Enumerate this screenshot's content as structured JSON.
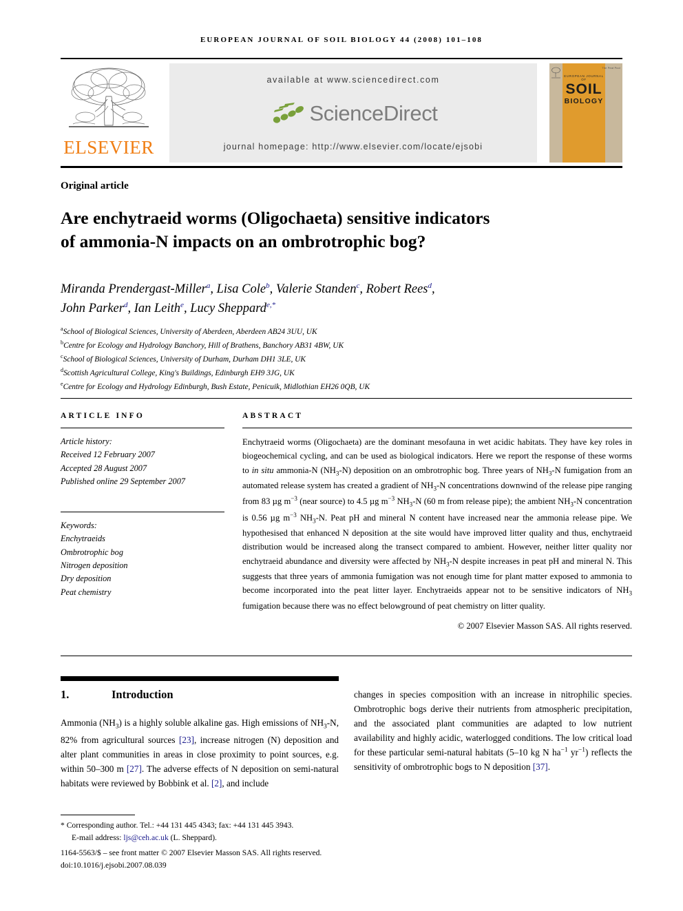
{
  "running_head": "EUROPEAN JOURNAL OF SOIL BIOLOGY 44 (2008) 101–108",
  "masthead": {
    "publisher": "ELSEVIER",
    "available_at": "available at www.sciencedirect.com",
    "sciencedirect": "ScienceDirect",
    "journal_homepage": "journal homepage: http://www.elsevier.com/locate/ejsobi",
    "cover": {
      "journal_line": "EUROPEAN JOURNAL OF",
      "title_line1": "SOIL",
      "title_line2": "BIOLOGY",
      "corner_note": "The Peat Pool"
    },
    "colors": {
      "elsevier_orange": "#F07E13",
      "sciencedirect_grey": "#7d7d7d",
      "sciencedirect_green": "#79A03A",
      "banner_grey": "#ebebeb",
      "cover_orange": "#E09B2D"
    }
  },
  "article_type": "Original article",
  "title_line1": "Are enchytraeid worms (Oligochaeta) sensitive indicators",
  "title_line2": "of ammonia-N impacts on an ombrotrophic bog?",
  "authors_line1_parts": [
    {
      "name": "Miranda Prendergast-Miller",
      "sup": "a"
    },
    {
      "name": "Lisa Cole",
      "sup": "b"
    },
    {
      "name": "Valerie Standen",
      "sup": "c"
    },
    {
      "name": "Robert Rees",
      "sup": "d"
    }
  ],
  "authors_line2_parts": [
    {
      "name": "John Parker",
      "sup": "d"
    },
    {
      "name": "Ian Leith",
      "sup": "e"
    },
    {
      "name": "Lucy Sheppard",
      "sup": "e,*"
    }
  ],
  "affiliations": [
    {
      "marker": "a",
      "text": "School of Biological Sciences, University of Aberdeen, Aberdeen AB24 3UU, UK"
    },
    {
      "marker": "b",
      "text": "Centre for Ecology and Hydrology Banchory, Hill of Brathens, Banchory AB31 4BW, UK"
    },
    {
      "marker": "c",
      "text": "School of Biological Sciences, University of Durham, Durham DH1 3LE, UK"
    },
    {
      "marker": "d",
      "text": "Scottish Agricultural College, King's Buildings, Edinburgh EH9 3JG, UK"
    },
    {
      "marker": "e",
      "text": "Centre for Ecology and Hydrology Edinburgh, Bush Estate, Penicuik, Midlothian EH26 0QB, UK"
    }
  ],
  "article_info": {
    "heading": "ARTICLE INFO",
    "history_label": "Article history:",
    "received": "Received 12 February 2007",
    "accepted": "Accepted 28 August 2007",
    "published": "Published online 29 September 2007",
    "keywords_label": "Keywords:",
    "keywords": [
      "Enchytraeids",
      "Ombrotrophic bog",
      "Nitrogen deposition",
      "Dry deposition",
      "Peat chemistry"
    ]
  },
  "abstract": {
    "heading": "ABSTRACT",
    "paragraph": "Enchytraeid worms (Oligochaeta) are the dominant mesofauna in wet acidic habitats. They have key roles in biogeochemical cycling, and can be used as biological indicators. Here we report the response of these worms to in situ ammonia-N (NH3-N) deposition on an ombrotrophic bog. Three years of NH3-N fumigation from an automated release system has created a gradient of NH3-N concentrations downwind of the release pipe ranging from 83 µg m−3 (near source) to 4.5 µg m−3 NH3-N (60 m from release pipe); the ambient NH3-N concentration is 0.56 µg m−3 NH3-N. Peat pH and mineral N content have increased near the ammonia release pipe. We hypothesised that enhanced N deposition at the site would have improved litter quality and thus, enchytraeid distribution would be increased along the transect compared to ambient. However, neither litter quality nor enchytraeid abundance and diversity were affected by NH3-N despite increases in peat pH and mineral N. This suggests that three years of ammonia fumigation was not enough time for plant matter exposed to ammonia to become incorporated into the peat litter layer. Enchytraeids appear not to be sensitive indicators of NH3 fumigation because there was no effect belowground of peat chemistry on litter quality.",
    "copyright": "© 2007 Elsevier Masson SAS. All rights reserved."
  },
  "section": {
    "number": "1.",
    "heading": "Introduction"
  },
  "body": {
    "left_paragraph": "Ammonia (NH3) is a highly soluble alkaline gas. High emissions of NH3-N, 82% from agricultural sources [23], increase nitrogen (N) deposition and alter plant communities in areas in close proximity to point sources, e.g. within 50–300 m [27]. The adverse effects of N deposition on semi-natural habitats were reviewed by Bobbink et al. [2], and include",
    "right_paragraph": "changes in species composition with an increase in nitrophilic species. Ombrotrophic bogs derive their nutrients from atmospheric precipitation, and the associated plant communities are adapted to low nutrient availability and highly acidic, waterlogged conditions. The low critical load for these particular semi-natural habitats (5–10 kg N ha−1 yr−1) reflects the sensitivity of ombrotrophic bogs to N deposition [37]."
  },
  "footer": {
    "corresponding": "* Corresponding author. Tel.: +44 131 445 4343; fax: +44 131 445 3943.",
    "email_label": "E-mail address:",
    "email": "ljs@ceh.ac.uk",
    "email_suffix": "(L. Sheppard).",
    "front_matter": "1164-5563/$ – see front matter © 2007 Elsevier Masson SAS. All rights reserved.",
    "doi": "doi:10.1016/j.ejsobi.2007.08.039"
  }
}
